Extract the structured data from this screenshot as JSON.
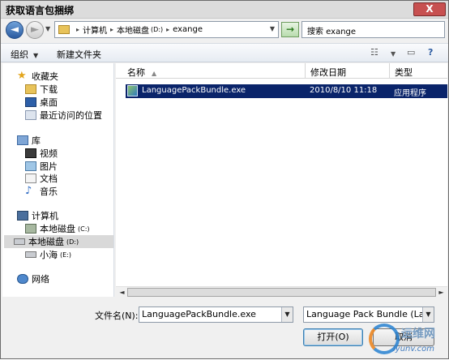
{
  "window": {
    "title": "获取语言包捆绑",
    "close_label": "X"
  },
  "nav": {
    "back_glyph": "◄",
    "forward_glyph": "►",
    "address": {
      "crumb1": "计算机",
      "crumb2": "本地磁盘",
      "crumb2_sub": "(D:)",
      "crumb3": "exange",
      "separator": "▸"
    },
    "refresh_glyph": "→",
    "search_placeholder": "搜索 exange"
  },
  "toolbar": {
    "organize_label": "组织",
    "new_folder_label": "新建文件夹",
    "view_glyph": "☷",
    "preview_glyph": "▭",
    "help_glyph": "?"
  },
  "sidebar": {
    "favorites": {
      "label": "收藏夹",
      "items": [
        "下载",
        "桌面",
        "最近访问的位置"
      ]
    },
    "libraries": {
      "label": "库",
      "items": [
        "视频",
        "图片",
        "文档",
        "音乐"
      ]
    },
    "computer": {
      "label": "计算机",
      "drives": [
        {
          "label": "本地磁盘",
          "letter": "(C:)"
        },
        {
          "label": "本地磁盘",
          "letter": "(D:)"
        },
        {
          "label": "小海",
          "letter": "(E:)"
        }
      ]
    },
    "network": {
      "label": "网络"
    }
  },
  "files": {
    "columns": {
      "name": "名称",
      "modified": "修改日期",
      "type": "类型"
    },
    "rows": [
      {
        "name": "LanguagePackBundle.exe",
        "modified": "2010/8/10 11:18",
        "type": "应用程序"
      }
    ]
  },
  "footer": {
    "filename_label": "文件名(N):",
    "filename_value": "LanguagePackBundle.exe",
    "filetype_value": "Language Pack Bundle (Lang",
    "open_label": "打开(O)",
    "cancel_label": "取消"
  },
  "watermark": {
    "brand_cn": "运维网",
    "url": "iyunv.com"
  },
  "colors": {
    "selection": "#0a246a",
    "accent": "#2a5aa0"
  }
}
